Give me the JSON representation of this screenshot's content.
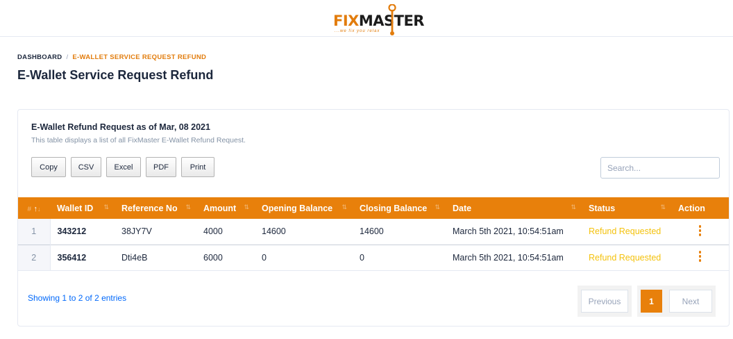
{
  "brand": {
    "name_part1": "FIX",
    "name_part2": "MASTER",
    "tagline": "...we fix you relax",
    "accent_color": "#e8800b"
  },
  "breadcrumb": {
    "home": "DASHBOARD",
    "separator": "/",
    "current": "E-WALLET SERVICE REQUEST REFUND"
  },
  "page_title": "E-Wallet Service Request Refund",
  "card": {
    "title": "E-Wallet Refund Request as of Mar, 08 2021",
    "subtitle": "This table displays a list of all FixMaster E-Wallet Refund Request."
  },
  "export_buttons": {
    "copy": "Copy",
    "csv": "CSV",
    "excel": "Excel",
    "pdf": "PDF",
    "print": "Print"
  },
  "search": {
    "placeholder": "Search...",
    "value": ""
  },
  "table": {
    "columns": {
      "index": "#",
      "wallet_id": "Wallet ID",
      "reference_no": "Reference No",
      "amount": "Amount",
      "opening_balance": "Opening Balance",
      "closing_balance": "Closing Balance",
      "date": "Date",
      "status": "Status",
      "action": "Action"
    },
    "rows": [
      {
        "index": "1",
        "wallet_id": "343212",
        "reference_no": "38JY7V",
        "amount": "4000",
        "opening_balance": "14600",
        "closing_balance": "14600",
        "date": "March 5th 2021, 10:54:51am",
        "status": "Refund Requested"
      },
      {
        "index": "2",
        "wallet_id": "356412",
        "reference_no": "Dti4eB",
        "amount": "6000",
        "opening_balance": "0",
        "closing_balance": "0",
        "date": "March 5th 2021, 10:54:51am",
        "status": "Refund Requested"
      }
    ]
  },
  "footer": {
    "info": "Showing 1 to 2 of 2 entries"
  },
  "pagination": {
    "previous": "Previous",
    "current_page": "1",
    "next": "Next"
  },
  "colors": {
    "header_bg": "#e8800b",
    "status_pending": "#f4c20d",
    "link": "#0168fa"
  }
}
